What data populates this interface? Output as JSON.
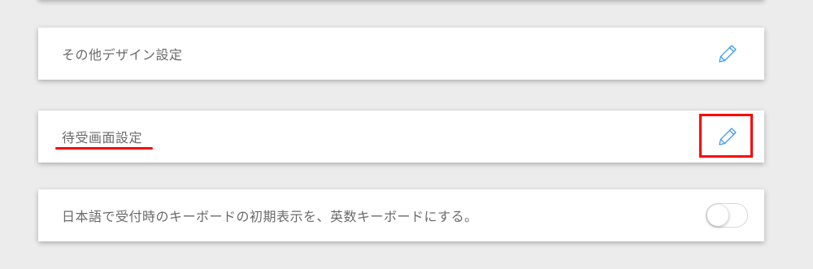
{
  "settings": {
    "other_design": {
      "label": "その他デザイン設定",
      "action_icon": "pencil-icon"
    },
    "standby_screen": {
      "label": "待受画面設定",
      "action_icon": "pencil-icon"
    },
    "keyboard_default": {
      "label": "日本語で受付時のキーボードの初期表示を、英数キーボードにする。",
      "toggle_on": false
    }
  },
  "colors": {
    "background": "#ececec",
    "card": "#ffffff",
    "label_text": "#6a6a6a",
    "icon_accent": "#3b9df0",
    "annotation": "#ff0000"
  }
}
